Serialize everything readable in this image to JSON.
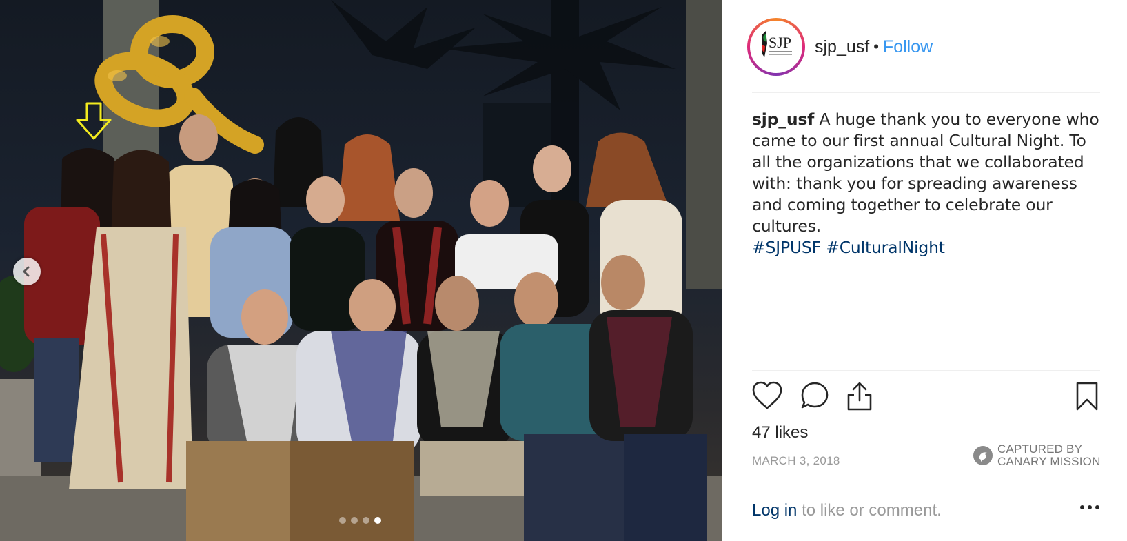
{
  "post": {
    "username": "sjp_usf",
    "separator": "•",
    "follow_label": "Follow",
    "avatar_icon": "sjp-logo-icon",
    "caption": {
      "user": "sjp_usf",
      "text": "A huge thank you to everyone who came to our first annual Cultural Night. To all the organizations that we collaborated with: thank you for spreading awareness and coming together to celebrate our cultures.",
      "hashtags": [
        "#SJPUSF",
        "#CulturalNight"
      ]
    },
    "likes": "47 likes",
    "date": "MARCH 3, 2018",
    "login_label": "Log in",
    "comment_prompt": "to like or comment.",
    "carousel": {
      "slides": 4,
      "active_slide": 4
    }
  },
  "logo": {
    "initials": "SJP"
  },
  "watermark": {
    "line1": "CAPTURED BY",
    "line2": "CANARY MISSION"
  },
  "balloon": {
    "text": "8"
  },
  "colors": {
    "link": "#3897f0",
    "hashtag": "#003569",
    "muted": "#999999",
    "annotation_arrow": "#f2ea1f",
    "balloon": "#d4a325"
  },
  "icons": [
    "chevron-left-icon",
    "heart-icon",
    "comment-icon",
    "share-icon",
    "bookmark-icon",
    "more-icon",
    "canary-logo-icon",
    "down-arrow-icon"
  ]
}
